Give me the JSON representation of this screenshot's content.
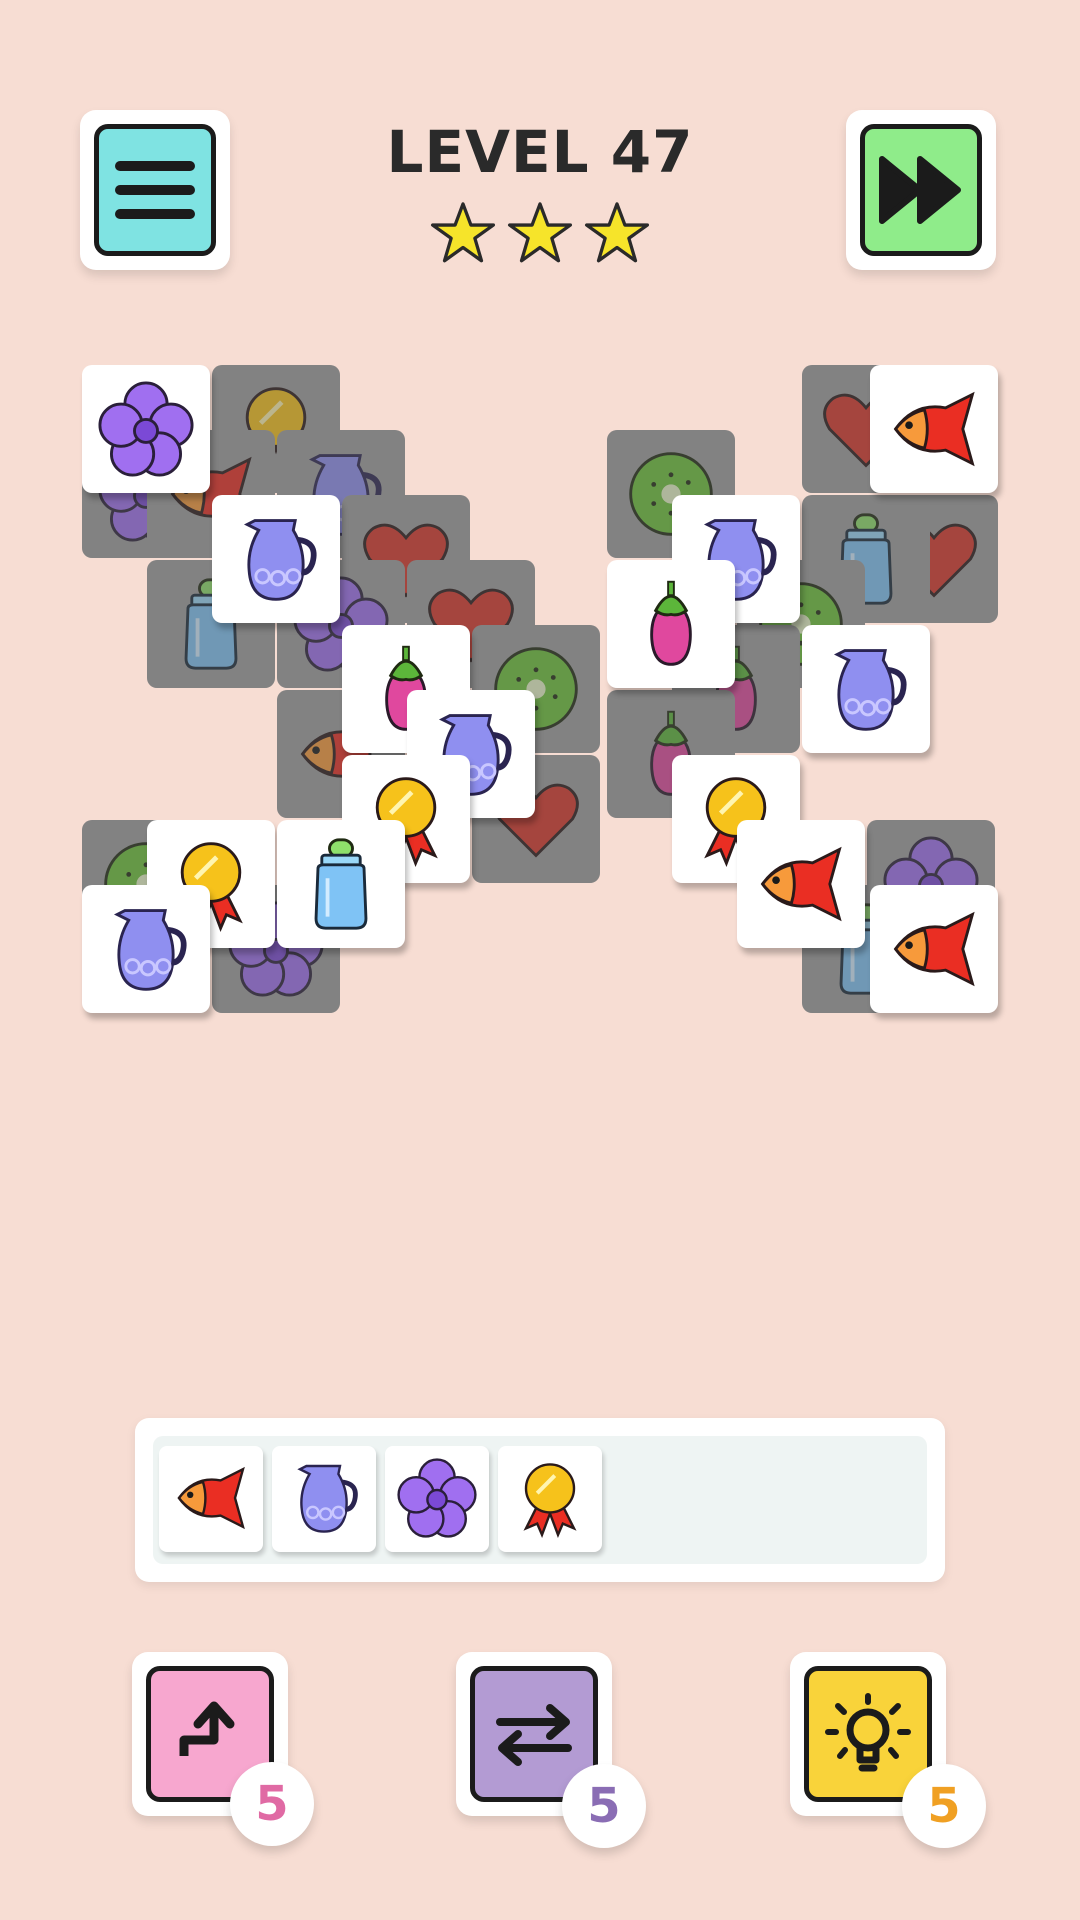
{
  "header": {
    "level_label": "LEVEL 47",
    "stars": 3,
    "menu_icon": "hamburger-menu-icon",
    "skip_icon": "fast-forward-icon",
    "colors": {
      "menu_bg": "#7fe3e2",
      "skip_bg": "#8fec8a",
      "star": "#f6e42a"
    }
  },
  "board": {
    "tiles": [
      {
        "row": 0,
        "col": 0,
        "type": "flower",
        "free": true
      },
      {
        "row": 0,
        "col": 1,
        "type": "medal",
        "free": false
      },
      {
        "row": 1,
        "col": 0,
        "type": "flower",
        "free": false
      },
      {
        "row": 1,
        "col": 1,
        "type": "fish",
        "free": false
      },
      {
        "row": 1,
        "col": 2,
        "type": "jug",
        "free": false
      },
      {
        "row": 2,
        "col": 1,
        "type": "jug",
        "free": true
      },
      {
        "row": 2,
        "col": 2,
        "type": "heart",
        "free": false
      },
      {
        "row": 3,
        "col": 1,
        "type": "bottle",
        "free": false
      },
      {
        "row": 3,
        "col": 2,
        "type": "flower",
        "free": false
      },
      {
        "row": 3,
        "col": 3,
        "type": "heart",
        "free": false
      },
      {
        "row": 4,
        "col": 2,
        "type": "eggplant",
        "free": true
      },
      {
        "row": 4,
        "col": 3,
        "type": "kiwi",
        "free": false
      },
      {
        "row": 5,
        "col": 2,
        "type": "fish",
        "free": false
      },
      {
        "row": 5,
        "col": 3,
        "type": "jug",
        "free": true
      },
      {
        "row": 6,
        "col": 2,
        "type": "medal",
        "free": true
      },
      {
        "row": 6,
        "col": 3,
        "type": "heart",
        "free": false
      },
      {
        "row": 2,
        "col": 6,
        "type": "heart",
        "free": false
      },
      {
        "row": 0,
        "col": 5,
        "type": "heart",
        "free": false
      },
      {
        "row": 0,
        "col": 6,
        "type": "fish",
        "free": true
      },
      {
        "row": 1,
        "col": 4,
        "type": "kiwi",
        "free": false
      },
      {
        "row": 2,
        "col": 4,
        "type": "jug",
        "free": true
      },
      {
        "row": 2,
        "col": 5,
        "type": "bottle",
        "free": false
      },
      {
        "row": 3,
        "col": 4,
        "type": "eggplant",
        "free": true
      },
      {
        "row": 3,
        "col": 5,
        "type": "kiwi",
        "free": false
      },
      {
        "row": 4,
        "col": 4,
        "type": "eggplant",
        "free": false
      },
      {
        "row": 4,
        "col": 5,
        "type": "jug",
        "free": true
      },
      {
        "row": 5,
        "col": 4,
        "type": "eggplant",
        "free": false
      },
      {
        "row": 6,
        "col": 4,
        "type": "medal",
        "free": true
      },
      {
        "row": 7,
        "col": 0,
        "type": "kiwi",
        "free": false
      },
      {
        "row": 7,
        "col": 1,
        "type": "medal",
        "free": true
      },
      {
        "row": 8,
        "col": 0,
        "type": "jug",
        "free": true
      },
      {
        "row": 8,
        "col": 1,
        "type": "flower",
        "free": false
      },
      {
        "row": 7,
        "col": 2,
        "type": "bottle",
        "free": true
      },
      {
        "row": 7,
        "col": 5,
        "type": "fish",
        "free": true
      },
      {
        "row": 7,
        "col": 6,
        "type": "flower",
        "free": false
      },
      {
        "row": 8,
        "col": 5,
        "type": "bottle",
        "free": false
      },
      {
        "row": 8,
        "col": 6,
        "type": "fish",
        "free": true
      }
    ]
  },
  "tray": {
    "slots": [
      "fish",
      "jug",
      "flower",
      "medal"
    ],
    "capacity": 7
  },
  "powerups": [
    {
      "name": "undo",
      "icon": "undo-arrow-icon",
      "count": "5",
      "color": "#f7a7cf",
      "badge_color": "#e06aa4"
    },
    {
      "name": "shuffle",
      "icon": "shuffle-icon",
      "count": "5",
      "color": "#b39bd3",
      "badge_color": "#8a6db4"
    },
    {
      "name": "hint",
      "icon": "lightbulb-icon",
      "count": "5",
      "color": "#f9d33a",
      "badge_color": "#f0a023"
    }
  ]
}
